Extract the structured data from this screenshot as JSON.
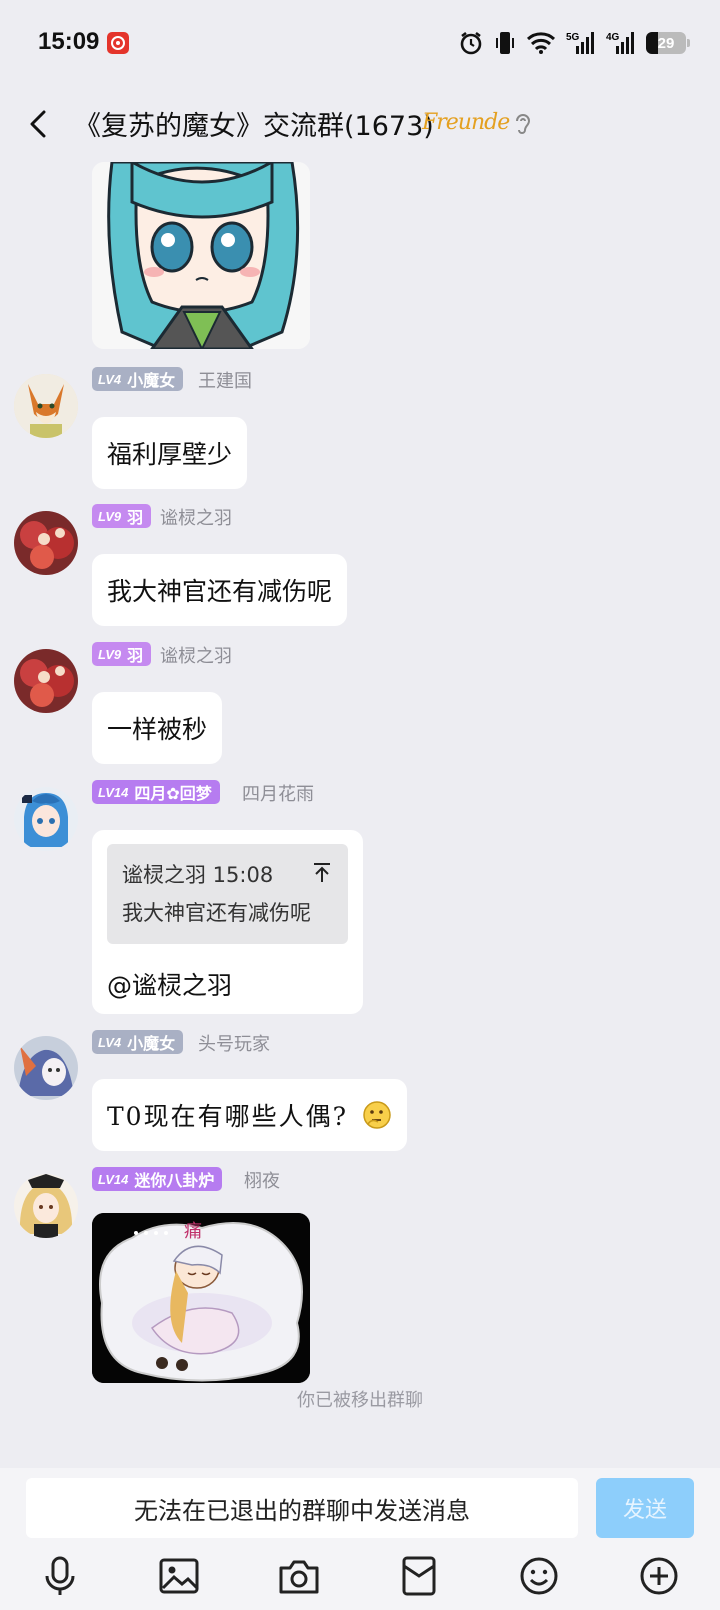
{
  "status_bar": {
    "time": "15:09",
    "app_badge_icon": "netease-music-icon",
    "icons": [
      "alarm-icon",
      "vibrate-icon",
      "wifi-icon",
      "signal-5g-icon",
      "signal-4g-icon"
    ],
    "network_5g": "5G",
    "network_4g": "4G",
    "battery_level": "29"
  },
  "header": {
    "back_icon": "chevron-left-icon",
    "title": "《复苏的魔女》交流群(1673)",
    "badge_text": "Freunde",
    "ear_icon": "ear-icon"
  },
  "messages": [
    {
      "type": "image",
      "description": "sticker"
    },
    {
      "type": "text",
      "level": "LV4",
      "title": "小魔女",
      "sender": "王建国",
      "text": "福利厚壁少"
    },
    {
      "type": "text",
      "level": "LV9",
      "title": "羽",
      "sender": "谧棂之羽",
      "text": "我大神官还有减伤呢"
    },
    {
      "type": "text",
      "level": "LV9",
      "title": "羽",
      "sender": "谧棂之羽",
      "text": "一样被秒"
    },
    {
      "type": "reply",
      "level": "LV14",
      "title": "四月✿回梦",
      "sender": "四月花雨",
      "quote": {
        "author_time": "谧棂之羽 15:08",
        "text": "我大神官还有减伤呢"
      },
      "text": "@谧棂之羽"
    },
    {
      "type": "text",
      "level": "LV4",
      "title": "小魔女",
      "sender": "头号玩家",
      "text": "T0现在有哪些人偶?"
    },
    {
      "type": "image",
      "level": "LV14",
      "title": "迷你八卦炉",
      "sender": "栩夜",
      "sticker_text": "痛"
    }
  ],
  "system_notice": "你已被移出群聊",
  "input": {
    "placeholder": "无法在已退出的群聊中发送消息",
    "send_label": "发送"
  },
  "toolbar": [
    "microphone-icon",
    "image-icon",
    "camera-icon",
    "red-packet-icon",
    "emoji-icon",
    "plus-icon"
  ],
  "colors": {
    "background": "#ededf2",
    "send_button": "#8dcefb",
    "badge_gray": "#a9b0c4",
    "badge_purple": "#c58af0"
  }
}
